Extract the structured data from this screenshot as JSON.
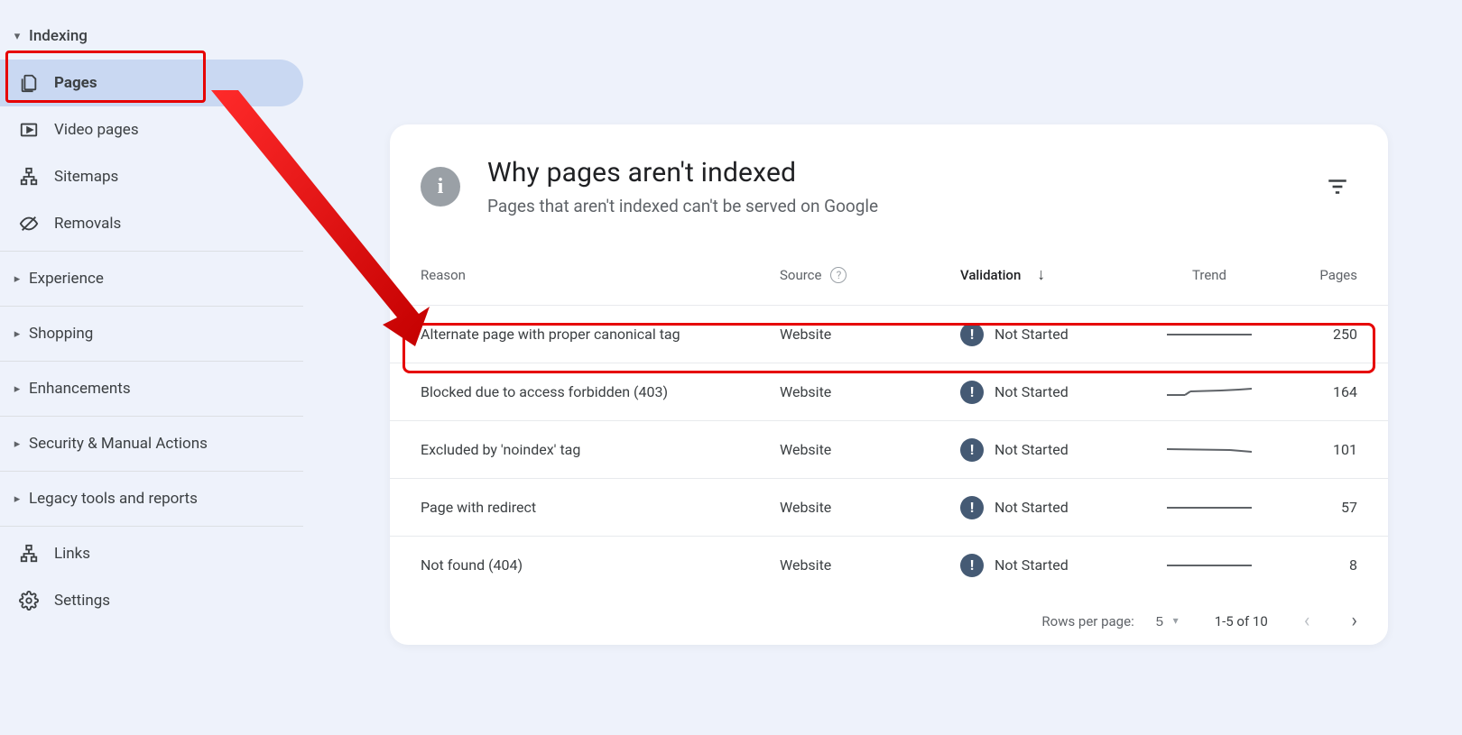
{
  "sidebar": {
    "indexing_label": "Indexing",
    "pages_label": "Pages",
    "video_label": "Video pages",
    "sitemaps_label": "Sitemaps",
    "removals_label": "Removals",
    "experience_label": "Experience",
    "shopping_label": "Shopping",
    "enhancements_label": "Enhancements",
    "security_label": "Security & Manual Actions",
    "legacy_label": "Legacy tools and reports",
    "links_label": "Links",
    "settings_label": "Settings"
  },
  "card": {
    "title": "Why pages aren't indexed",
    "subtitle": "Pages that aren't indexed can't be served on Google"
  },
  "table": {
    "headers": {
      "reason": "Reason",
      "source": "Source",
      "validation": "Validation",
      "trend": "Trend",
      "pages": "Pages"
    },
    "not_started": "Not Started",
    "rows": [
      {
        "reason": "Alternate page with proper canonical tag",
        "source": "Website",
        "pages": "250"
      },
      {
        "reason": "Blocked due to access forbidden (403)",
        "source": "Website",
        "pages": "164"
      },
      {
        "reason": "Excluded by 'noindex' tag",
        "source": "Website",
        "pages": "101"
      },
      {
        "reason": "Page with redirect",
        "source": "Website",
        "pages": "57"
      },
      {
        "reason": "Not found (404)",
        "source": "Website",
        "pages": "8"
      }
    ]
  },
  "pager": {
    "rows_label": "Rows per page:",
    "per_page": "5",
    "range": "1-5 of 10"
  }
}
